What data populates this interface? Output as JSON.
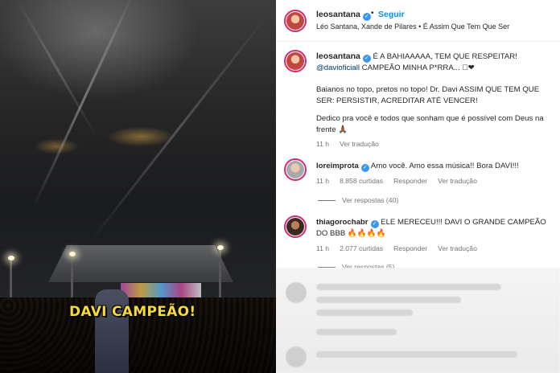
{
  "media": {
    "caption": "DAVI CAMPEÃO!"
  },
  "post": {
    "username": "leosantana",
    "follow_label": "Seguir",
    "audio": "Léo Santana, Xande de Pilares • É Assim Que Tem Que Ser"
  },
  "caption_comment": {
    "username": "leosantana",
    "line1": "É A BAHIAAAAA, TEM QUE RESPEITAR!",
    "mention": "@davioficiall",
    "line2_rest": " CAMPEÃO MINHA P*RRA... 🏾❤",
    "para2": "Baianos no topo, pretos no topo! Dr. Davi ASSIM QUE TEM QUE SER: PERSISTIR, ACREDITAR ATÉ VENCER!",
    "para3": "Dedico pra você e todos que sonham que é possível com Deus na frente 🙏🏾",
    "time": "11 h",
    "see_translation": "Ver tradução"
  },
  "comments": [
    {
      "username": "loreimprota",
      "text": "Amo você. Amo essa música!! Bora DAVI!!!",
      "time": "11 h",
      "likes": "8.858 curtidas",
      "reply": "Responder",
      "see_translation": "Ver tradução",
      "view_replies": "Ver respostas (40)"
    },
    {
      "username": "thiagorochabr",
      "text": "ELE MERECEU!!! DAVI O GRANDE CAMPEÃO DO BBB 🔥🔥🔥🔥",
      "time": "11 h",
      "likes": "2.077 curtidas",
      "reply": "Responder",
      "see_translation": "Ver tradução",
      "view_replies": "Ver respostas (5)"
    }
  ],
  "icons": {
    "verified": "verified-badge-icon",
    "reply_line": "replies-divider"
  },
  "colors": {
    "caption_yellow": "#f6d93a",
    "follow_blue": "#0095f6",
    "verified_blue": "#3897f0",
    "story_ring": "#d62976"
  }
}
